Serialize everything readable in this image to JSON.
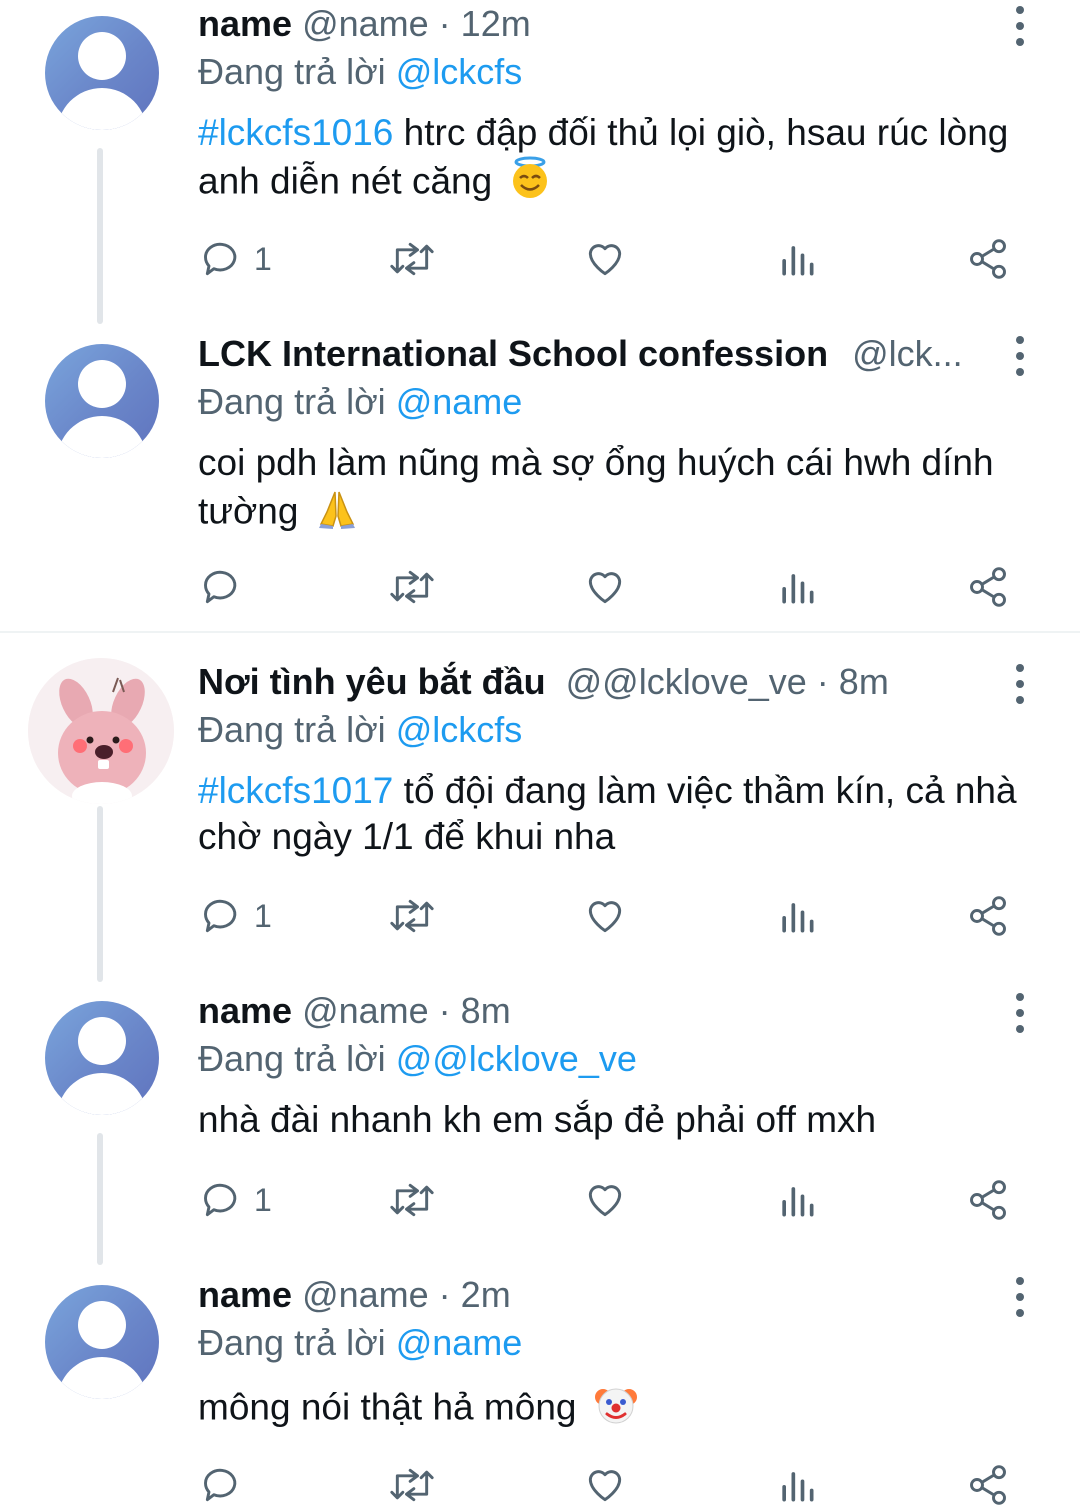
{
  "tweets": [
    {
      "name": "name",
      "handle": "@name",
      "dot": " · ",
      "time": "12m",
      "replying_prefix": "Đang trả lời ",
      "replying_to": "@lckcfs",
      "hashtag": "#lckcfs1016",
      "text": " htrc đập đối thủ lọi giò, hsau rúc lòng anh diễn nét căng",
      "emoji": "smiling-face-with-halo-icon",
      "reply_count": "1"
    },
    {
      "name": "LCK International School confession",
      "handle": "@lck...",
      "dot": "",
      "time": "",
      "replying_prefix": "Đang trả lời ",
      "replying_to": "@name",
      "hashtag": "",
      "text": "coi pdh làm nũng mà sợ ổng huých cái hwh dính tường",
      "emoji": "folded-hands-icon",
      "reply_count": ""
    },
    {
      "name": "Nơi tình yêu bắt đầu",
      "handle": "@@lcklove_ve",
      "dot": " · ",
      "time": "8m",
      "replying_prefix": "Đang trả lời ",
      "replying_to": "@lckcfs",
      "hashtag": "#lckcfs1017",
      "text": " tổ đội đang làm việc thầm kín, cả nhà chờ ngày 1/1 để khui nha",
      "emoji": "",
      "reply_count": "1"
    },
    {
      "name": "name",
      "handle": "@name",
      "dot": " · ",
      "time": "8m",
      "replying_prefix": "Đang trả lời ",
      "replying_to": "@@lcklove_ve",
      "hashtag": "",
      "text": "nhà đài nhanh kh em sắp đẻ phải off mxh",
      "emoji": "",
      "reply_count": "1"
    },
    {
      "name": "name",
      "handle": "@name",
      "dot": " · ",
      "time": "2m",
      "replying_prefix": "Đang trả lời ",
      "replying_to": "@name",
      "hashtag": "",
      "text": "mông nói thật hả mông",
      "emoji": "clown-face-icon",
      "reply_count": ""
    }
  ],
  "icons": {
    "reply": "reply-icon",
    "retweet": "retweet-icon",
    "like": "heart-icon",
    "views": "views-icon",
    "share": "share-icon",
    "more": "more-vertical-icon",
    "avatar_special": "pink-beaver-avatar"
  },
  "colors": {
    "link": "#1d9bf0",
    "secondary": "#536471",
    "text": "#0f1419",
    "thread_line": "#e1e5e9"
  }
}
